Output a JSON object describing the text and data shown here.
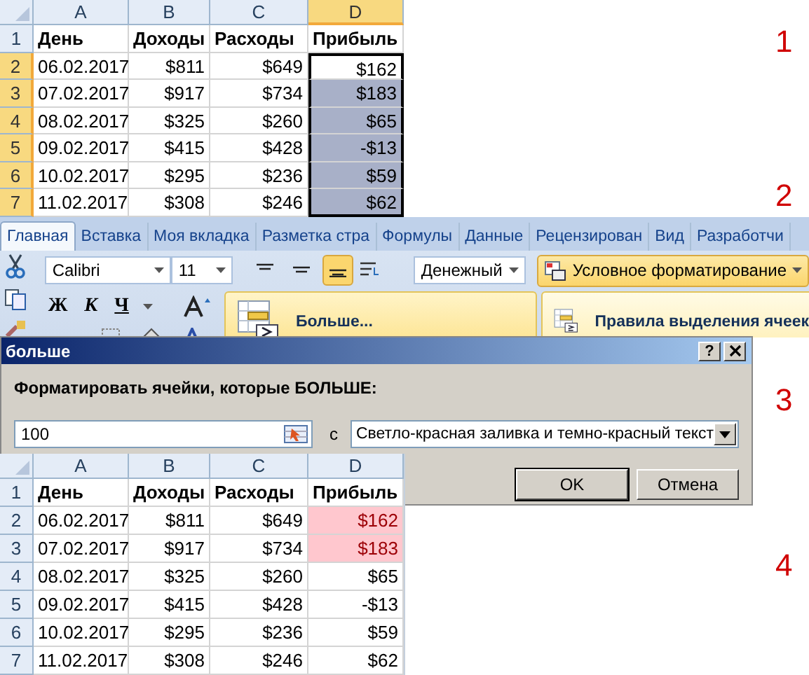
{
  "step_numbers": [
    "1",
    "2",
    "3",
    "4"
  ],
  "sheets": [
    {
      "kind": "selection",
      "columns": [
        {
          "label": "A",
          "selected": false
        },
        {
          "label": "B",
          "selected": false
        },
        {
          "label": "C",
          "selected": false
        },
        {
          "label": "D",
          "selected": true
        }
      ],
      "rows": [
        {
          "number": "1",
          "selected": false,
          "highlighted": false,
          "cells": [
            "День",
            "Доходы",
            "Расходы",
            "Прибыль"
          ]
        },
        {
          "number": "2",
          "selected": true,
          "highlighted": false,
          "cells": [
            "06.02.2017",
            "$811",
            "$649",
            "$162"
          ]
        },
        {
          "number": "3",
          "selected": true,
          "highlighted": true,
          "cells": [
            "07.02.2017",
            "$917",
            "$734",
            "$183"
          ]
        },
        {
          "number": "4",
          "selected": true,
          "highlighted": true,
          "cells": [
            "08.02.2017",
            "$325",
            "$260",
            "$65"
          ]
        },
        {
          "number": "5",
          "selected": true,
          "highlighted": true,
          "cells": [
            "09.02.2017",
            "$415",
            "$428",
            "-$13"
          ]
        },
        {
          "number": "6",
          "selected": true,
          "highlighted": true,
          "cells": [
            "10.02.2017",
            "$295",
            "$236",
            "$59"
          ]
        },
        {
          "number": "7",
          "selected": true,
          "highlighted": true,
          "cells": [
            "11.02.2017",
            "$308",
            "$246",
            "$62"
          ]
        }
      ]
    },
    {
      "kind": "conditional",
      "columns": [
        {
          "label": "A",
          "selected": false
        },
        {
          "label": "B",
          "selected": false
        },
        {
          "label": "C",
          "selected": false
        },
        {
          "label": "D",
          "selected": false
        }
      ],
      "rows": [
        {
          "number": "1",
          "selected": false,
          "highlighted": false,
          "cells": [
            "День",
            "Доходы",
            "Расходы",
            "Прибыль"
          ]
        },
        {
          "number": "2",
          "selected": false,
          "highlighted": true,
          "cells": [
            "06.02.2017",
            "$811",
            "$649",
            "$162"
          ]
        },
        {
          "number": "3",
          "selected": false,
          "highlighted": true,
          "cells": [
            "07.02.2017",
            "$917",
            "$734",
            "$183"
          ]
        },
        {
          "number": "4",
          "selected": false,
          "highlighted": false,
          "cells": [
            "08.02.2017",
            "$325",
            "$260",
            "$65"
          ]
        },
        {
          "number": "5",
          "selected": false,
          "highlighted": false,
          "cells": [
            "09.02.2017",
            "$415",
            "$428",
            "-$13"
          ]
        },
        {
          "number": "6",
          "selected": false,
          "highlighted": false,
          "cells": [
            "10.02.2017",
            "$295",
            "$236",
            "$59"
          ]
        },
        {
          "number": "7",
          "selected": false,
          "highlighted": false,
          "cells": [
            "11.02.2017",
            "$308",
            "$246",
            "$62"
          ]
        }
      ]
    }
  ],
  "ribbon": {
    "tabs": [
      {
        "label": "Главная",
        "selected": true
      },
      {
        "label": "Вставка",
        "selected": false
      },
      {
        "label": "Моя вкладка",
        "selected": false
      },
      {
        "label": "Разметка стра",
        "selected": false
      },
      {
        "label": "Формулы",
        "selected": false
      },
      {
        "label": "Данные",
        "selected": false
      },
      {
        "label": "Рецензирован",
        "selected": false
      },
      {
        "label": "Вид",
        "selected": false
      },
      {
        "label": "Разработчи",
        "selected": false
      }
    ],
    "font": "Calibri",
    "font_size": "11",
    "format_buttons": [
      "Ж",
      "К",
      "Ч"
    ],
    "alignment": [
      {
        "selected": false
      },
      {
        "selected": false
      },
      {
        "selected": true
      }
    ],
    "number_format": "Денежный",
    "conditional_formatting": "Условное форматирование",
    "menu_items": [
      {
        "label": "Больше...",
        "kind": "item"
      },
      {
        "label": "Правила выделения ячеек",
        "kind": "submenu"
      }
    ]
  },
  "dialog": {
    "title": "больше",
    "help": "?",
    "prompt": "Форматировать ячейки, которые БОЛЬШЕ:",
    "value": "100",
    "with_label": "с",
    "style": "Светло-красная заливка и темно-красный текст",
    "buttons": [
      "OK",
      "Отмена"
    ]
  }
}
